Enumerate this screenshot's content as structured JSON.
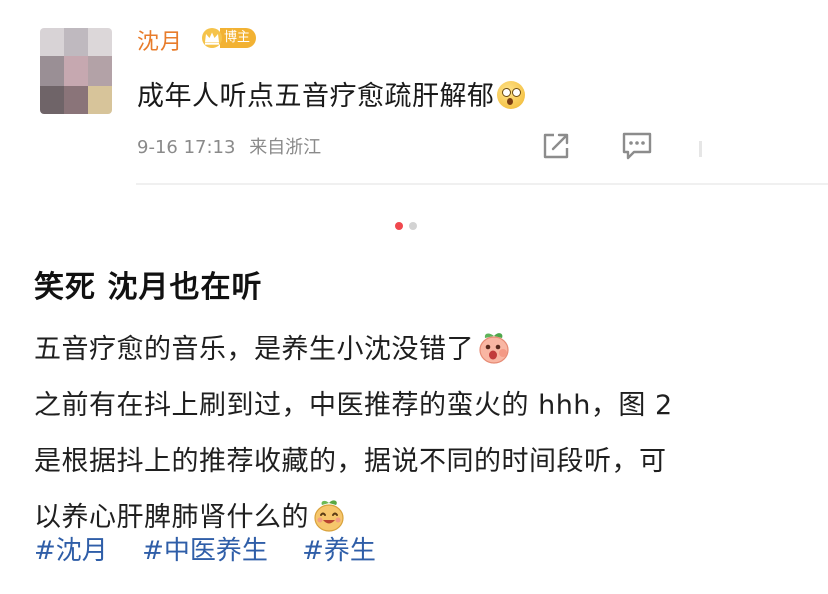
{
  "post": {
    "author": "沈月",
    "badge": "博主",
    "text": "成年人听点五音疗愈疏肝解郁",
    "time": "9-16 17:13",
    "location": "来自浙江"
  },
  "carousel": {
    "count": 2,
    "active": 0
  },
  "article": {
    "headline": "笑死 沈月也在听",
    "lines": [
      "五音疗愈的音乐，是养生小沈没错了",
      "之前有在抖上刷到过，中医推荐的蛮火的 hhh，图 2",
      "是根据抖上的推荐收藏的，据说不同的时间段听，可",
      "以养心肝脾肺肾什么的"
    ],
    "tags": [
      "#沈月",
      "#中医养生",
      "#养生"
    ]
  },
  "colors": {
    "author": "#e87c2b",
    "tag": "#2f5ea8",
    "dot_active": "#f0484e",
    "badge": "#f2b233"
  },
  "icons": [
    "crown-icon",
    "shocked-emoji-icon",
    "share-icon",
    "comment-icon",
    "peach-emoji-icon",
    "happy-emoji-icon"
  ]
}
